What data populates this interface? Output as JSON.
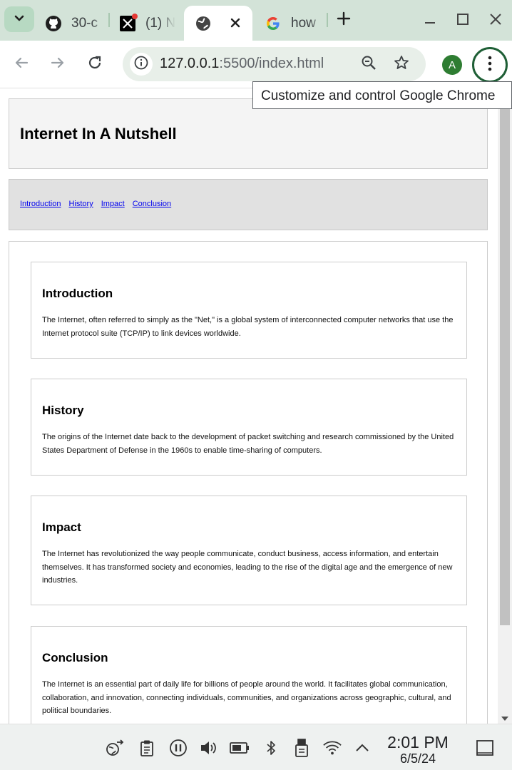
{
  "browser": {
    "tabs": [
      {
        "title": "30-c",
        "icon": "github-icon",
        "active": false
      },
      {
        "title": "(1) N",
        "icon": "x-twitter-icon",
        "active": false
      },
      {
        "title": "",
        "icon": "globe-icon",
        "active": true
      },
      {
        "title": "how",
        "icon": "google-icon",
        "active": false
      }
    ],
    "url_host": "127.0.0.1",
    "url_path": ":5500/index.html",
    "profile_initial": "A",
    "tooltip": "Customize and control Google Chrome",
    "accent_color": "#1f5f36",
    "tab_strip_color": "#d3e3d8"
  },
  "page": {
    "title": "Internet In A Nutshell",
    "nav": [
      "Introduction",
      "History",
      "Impact",
      "Conclusion"
    ],
    "sections": [
      {
        "heading": "Introduction",
        "text": "The Internet, often referred to simply as the \"Net,\" is a global system of interconnected computer networks that use the Internet protocol suite (TCP/IP) to link devices worldwide."
      },
      {
        "heading": "History",
        "text": "The origins of the Internet date back to the development of packet switching and research commissioned by the United States Department of Defense in the 1960s to enable time-sharing of computers."
      },
      {
        "heading": "Impact",
        "text": "The Internet has revolutionized the way people communicate, conduct business, access information, and entertain themselves. It has transformed society and economies, leading to the rise of the digital age and the emergence of new industries."
      },
      {
        "heading": "Conclusion",
        "text": "The Internet is an essential part of daily life for billions of people around the world. It facilitates global communication, collaboration, and innovation, connecting individuals, communities, and organizations across geographic, cultural, and political boundaries."
      }
    ]
  },
  "taskbar": {
    "time": "2:01 PM",
    "date": "6/5/24",
    "icons": [
      "globe-arrow-icon",
      "clipboard-icon",
      "pause-icon",
      "volume-icon",
      "battery-icon",
      "bluetooth-icon",
      "usb-drive-icon",
      "wifi-icon",
      "chevron-up-icon",
      "notifications-icon"
    ]
  }
}
